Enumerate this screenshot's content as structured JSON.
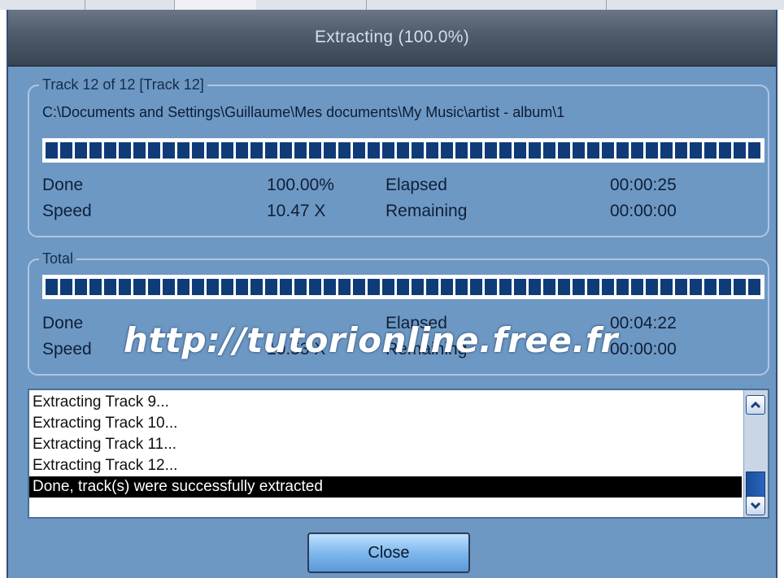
{
  "window": {
    "title": "Extracting (100.0%)"
  },
  "track": {
    "legend": "Track 12 of 12 [Track 12]",
    "path": "C:\\Documents and Settings\\Guillaume\\Mes documents\\My Music\\artist - album\\1",
    "progress_fraction": 1.0,
    "done_label": "Done",
    "done_value": "100.00%",
    "elapsed_label": "Elapsed",
    "elapsed_value": "00:00:25",
    "speed_label": "Speed",
    "speed_value": "10.47 X",
    "remaining_label": "Remaining",
    "remaining_value": "00:00:00"
  },
  "total": {
    "legend": "Total",
    "progress_fraction": 1.0,
    "done_label": "Done",
    "elapsed_label": "Elapsed",
    "elapsed_value": "00:04:22",
    "speed_label": "Speed",
    "speed_value": "10.53 X",
    "remaining_label": "Remaining",
    "remaining_value": "00:00:00"
  },
  "watermark": "http://tutorionline.free.fr",
  "log": {
    "lines": [
      "Extracting Track 9...",
      "Extracting Track 10...",
      "Extracting Track 11...",
      "Extracting Track 12...",
      "Done, track(s) were successfully extracted"
    ],
    "selected_index": 4
  },
  "buttons": {
    "close_label": "Close"
  },
  "icons": {
    "scroll_up": "chevron-up-icon",
    "scroll_down": "chevron-down-icon"
  },
  "colors": {
    "dialog_bg": "#6e98c4",
    "progress_fill": "#0f3c78",
    "titlebar": "#4f5b6b"
  }
}
